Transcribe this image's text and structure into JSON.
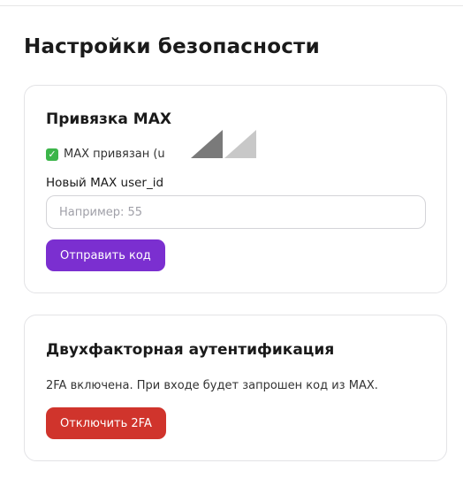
{
  "page": {
    "title": "Настройки безопасности"
  },
  "max_card": {
    "title": "Привязка MAX",
    "status_text": "MAX привязан (u",
    "status_icon": "check-icon",
    "field_label": "Новый MAX user_id",
    "input_placeholder": "Например: 55",
    "input_value": "",
    "send_button": "Отправить код",
    "accent_color": "#7b2fd0"
  },
  "twofa_card": {
    "title": "Двухфакторная аутентификация",
    "info_text": "2FA включена. При входе будет запрошен код из MAX.",
    "disable_button": "Отключить 2FA",
    "danger_color": "#d0342c"
  }
}
